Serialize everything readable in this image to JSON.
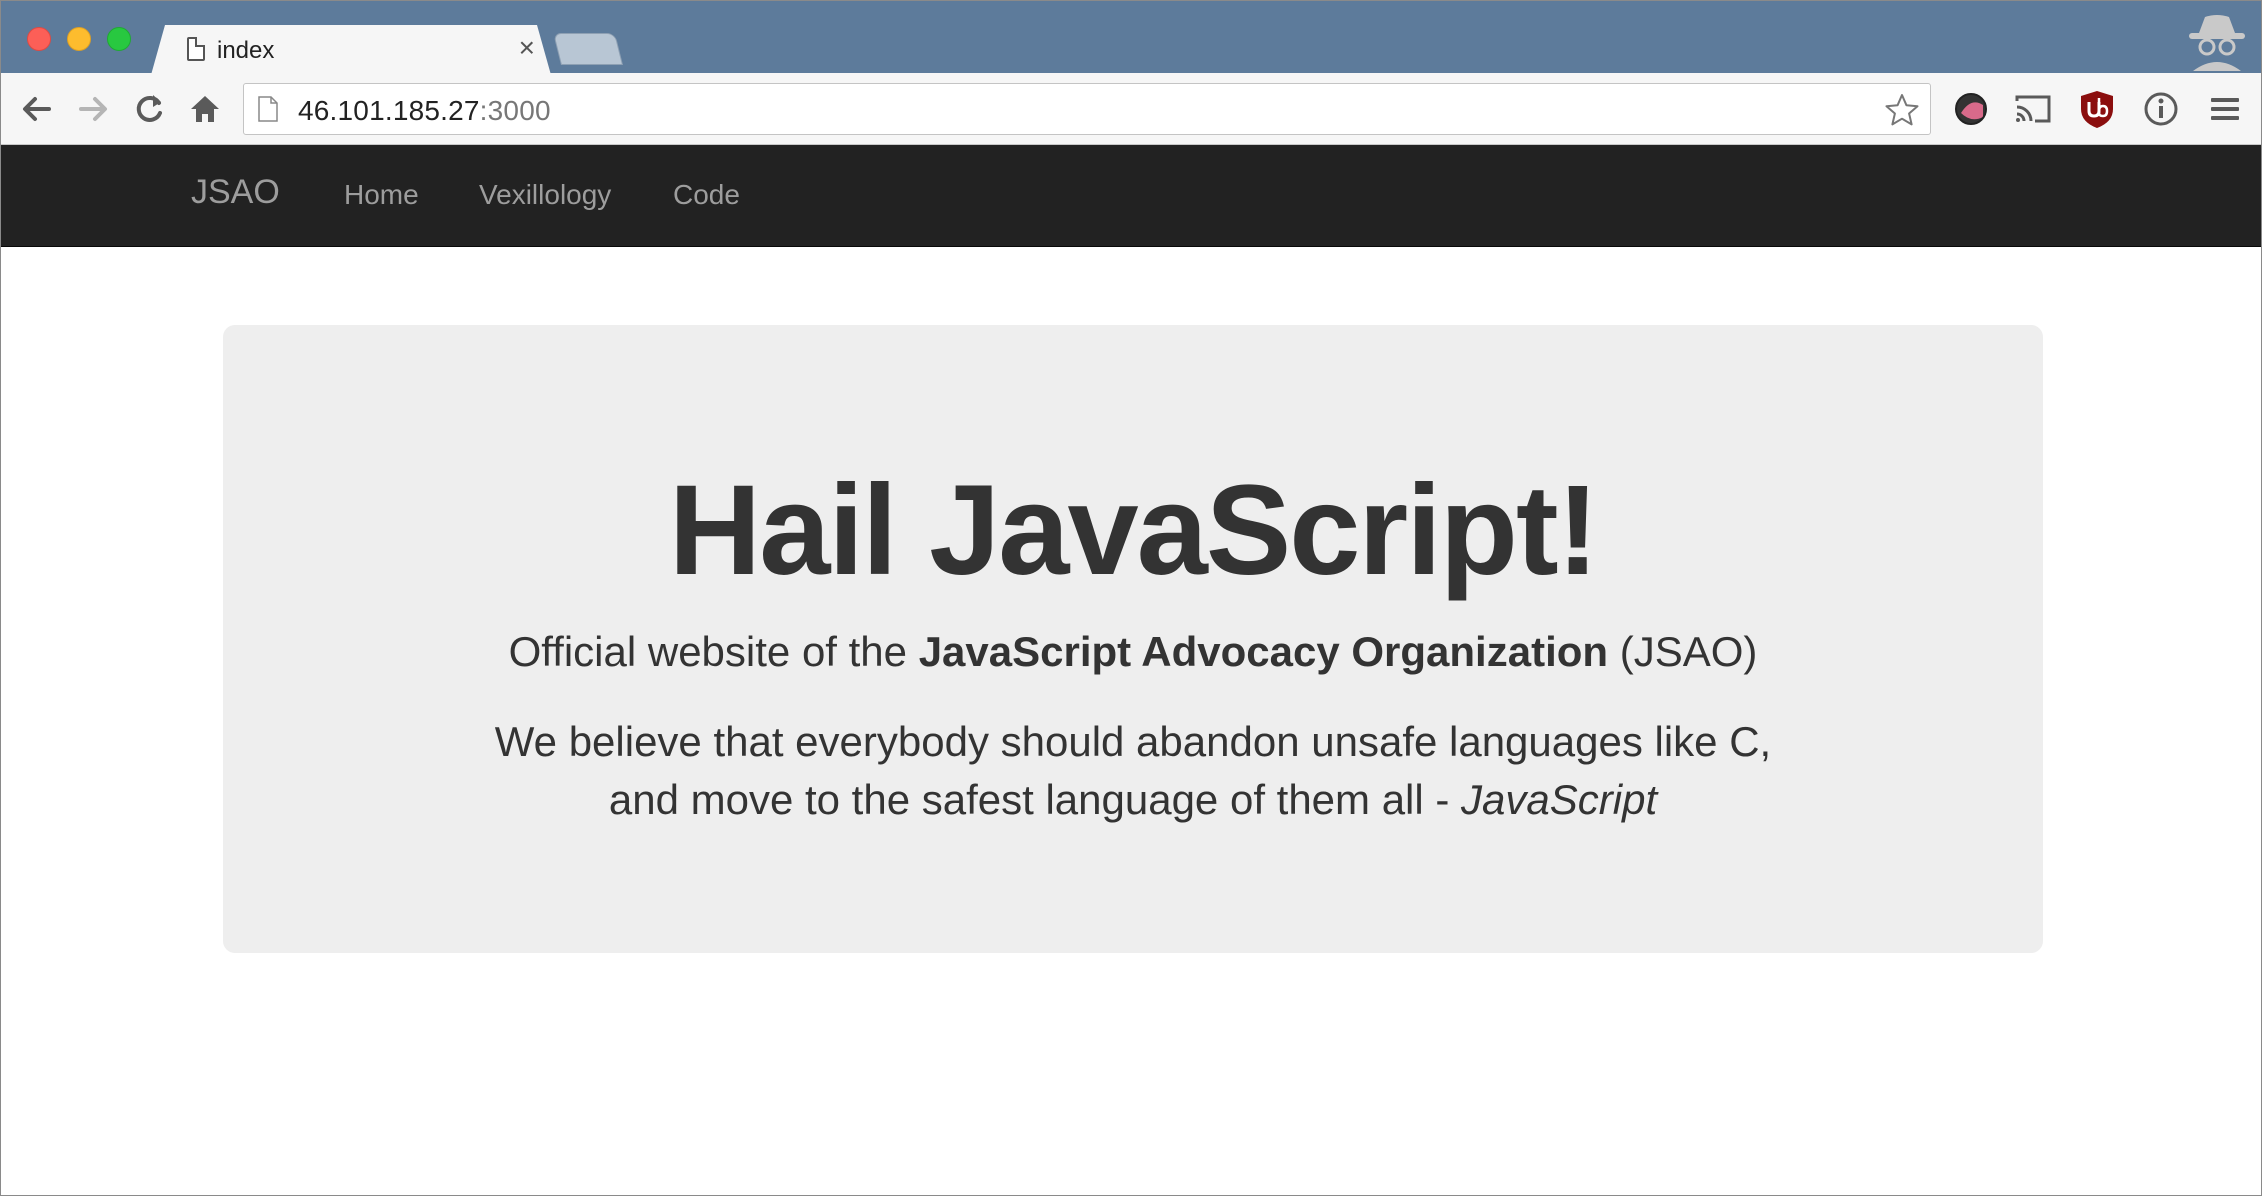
{
  "browser": {
    "tab": {
      "title": "index",
      "close": "×"
    },
    "address_bar": {
      "host": "46.101.185.27",
      "port": ":3000"
    },
    "colors": {
      "titlebar": "#5d7b9b",
      "toolbar": "#f6f6f6"
    },
    "toolbar_icons": [
      "back-icon",
      "forward-icon",
      "reload-icon",
      "home-icon",
      "star-icon",
      "extension-icon",
      "cast-icon",
      "ublock-icon",
      "info-icon",
      "menu-icon"
    ]
  },
  "navbar": {
    "brand": "JSAO",
    "links": [
      "Home",
      "Vexillology",
      "Code"
    ],
    "colors": {
      "background": "#222222",
      "link": "#9d9d9d"
    }
  },
  "jumbotron": {
    "heading": "Hail JavaScript!",
    "lead": {
      "prefix": "Official website of the ",
      "org": "JavaScript Advocacy Organization",
      "suffix": " (JSAO)"
    },
    "belief": {
      "line1": "We believe that everybody should abandon unsafe languages like C,",
      "line2_prefix": "and move to the safest language of them all - ",
      "line2_emph": "JavaScript"
    },
    "colors": {
      "background": "#eeeeee",
      "text": "#333333"
    }
  }
}
